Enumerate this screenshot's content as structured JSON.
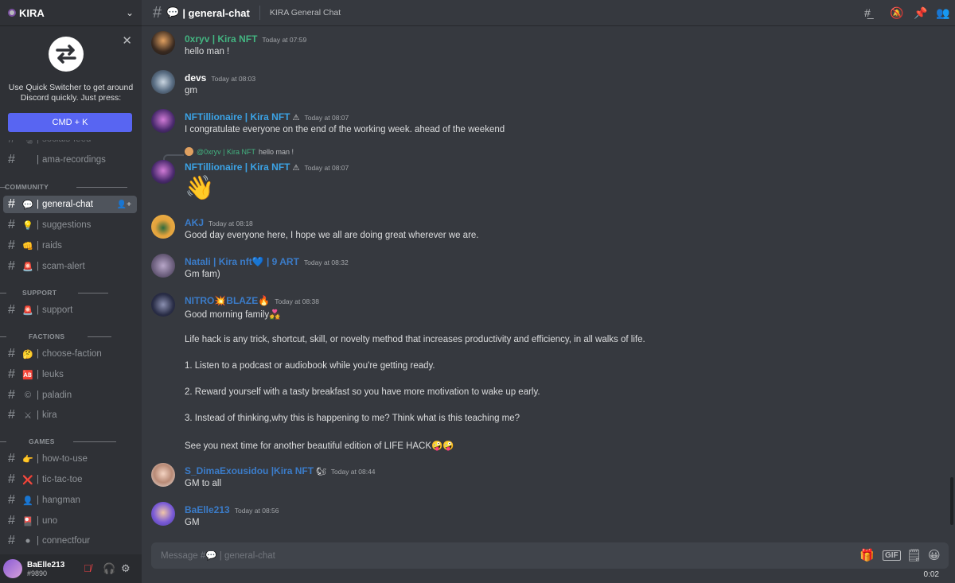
{
  "server": {
    "name": "KIRA"
  },
  "quick_switcher": {
    "text": "Use Quick Switcher to get around Discord quickly. Just press:",
    "button": "CMD + K"
  },
  "sidebar": {
    "channels": [
      {
        "name": "socials-feed",
        "emoji": "🗞",
        "partial": true
      },
      {
        "name": "ama-recordings",
        "emoji": ""
      },
      {
        "category": "COMMUNITY"
      },
      {
        "name": "general-chat",
        "emoji": "💬",
        "active": true
      },
      {
        "name": "suggestions",
        "emoji": "💡"
      },
      {
        "name": "raids",
        "emoji": "👊"
      },
      {
        "name": "scam-alert",
        "emoji": "🚨"
      },
      {
        "category": "SUPPORT"
      },
      {
        "name": "support",
        "emoji": "🚨"
      },
      {
        "category": "FACTIONS"
      },
      {
        "name": "choose-faction",
        "emoji": "🤔"
      },
      {
        "name": "leuks",
        "emoji": "🆎"
      },
      {
        "name": "paladin",
        "emoji": "©"
      },
      {
        "name": "kira",
        "emoji": "⚔"
      },
      {
        "category": "GAMES"
      },
      {
        "name": "how-to-use",
        "emoji": "👉"
      },
      {
        "name": "tic-tac-toe",
        "emoji": "❌"
      },
      {
        "name": "hangman",
        "emoji": "👤"
      },
      {
        "name": "uno",
        "emoji": "🎴"
      },
      {
        "name": "connectfour",
        "emoji": "⚫"
      }
    ]
  },
  "user": {
    "name": "BaElle213",
    "tag": "#9890"
  },
  "header": {
    "emoji": "💬",
    "channel": "| general-chat",
    "topic": "KIRA General Chat"
  },
  "messages": [
    {
      "user": "0xryv | Kira NFT",
      "color": "#43b581",
      "time": "Today at 07:59",
      "lines": [
        "hello man !"
      ]
    },
    {
      "user": "devs",
      "color": "#ffffff",
      "time": "Today at 08:03",
      "lines": [
        "gm"
      ]
    },
    {
      "user": "NFTillionaire | Kira NFT",
      "tag": "⚠",
      "color": "#3ba3e6",
      "time": "Today at 08:07",
      "lines": [
        "I congratulate everyone on the end of the working week. ahead of the weekend"
      ]
    },
    {
      "reply_user": "@0xryv | Kira NFT",
      "reply_text": "hello man !",
      "user": "NFTillionaire | Kira NFT",
      "tag": "⚠",
      "color": "#3ba3e6",
      "time": "Today at 08:07",
      "lines": [
        "👋"
      ]
    },
    {
      "user": "AKJ",
      "color": "#3b7cc9",
      "time": "Today at 08:18",
      "lines": [
        "Good day everyone here, I hope we all are doing great wherever we are."
      ]
    },
    {
      "user": "Natali | Kira nft💙 | 9 ART",
      "color": "#3b7cc9",
      "time": "Today at 08:32",
      "lines": [
        "Gm fam)"
      ]
    },
    {
      "user": "NITRO💥BLAZE🔥",
      "color": "#3b7cc9",
      "time": "Today at 08:38",
      "lines": [
        "Good morning family💑",
        "",
        "Life hack is any trick, shortcut, skill, or novelty method that increases productivity and efficiency, in all walks of life.",
        "",
        "1. Listen to a podcast or audiobook while you're getting ready.",
        "",
        "2. Reward yourself with a tasty breakfast so you have more motivation to wake up early.",
        "",
        "3. Instead of thinking,why this is happening to me? Think what is this teaching me?",
        "",
        "See you next time for another beautiful edition of LIFE HACK🤪🤪"
      ]
    },
    {
      "user": "S_DimaExousidou |Kira NFT",
      "tag": "🐿",
      "color": "#3b7cc9",
      "time": "Today at 08:44",
      "lines": [
        "GM to all"
      ]
    },
    {
      "user": "BaElle213",
      "color": "#3b7cc9",
      "time": "Today at 08:56",
      "lines": [
        "GM"
      ]
    }
  ],
  "composer": {
    "placeholder": "Message #💬 | general-chat"
  },
  "clock": "0:02"
}
